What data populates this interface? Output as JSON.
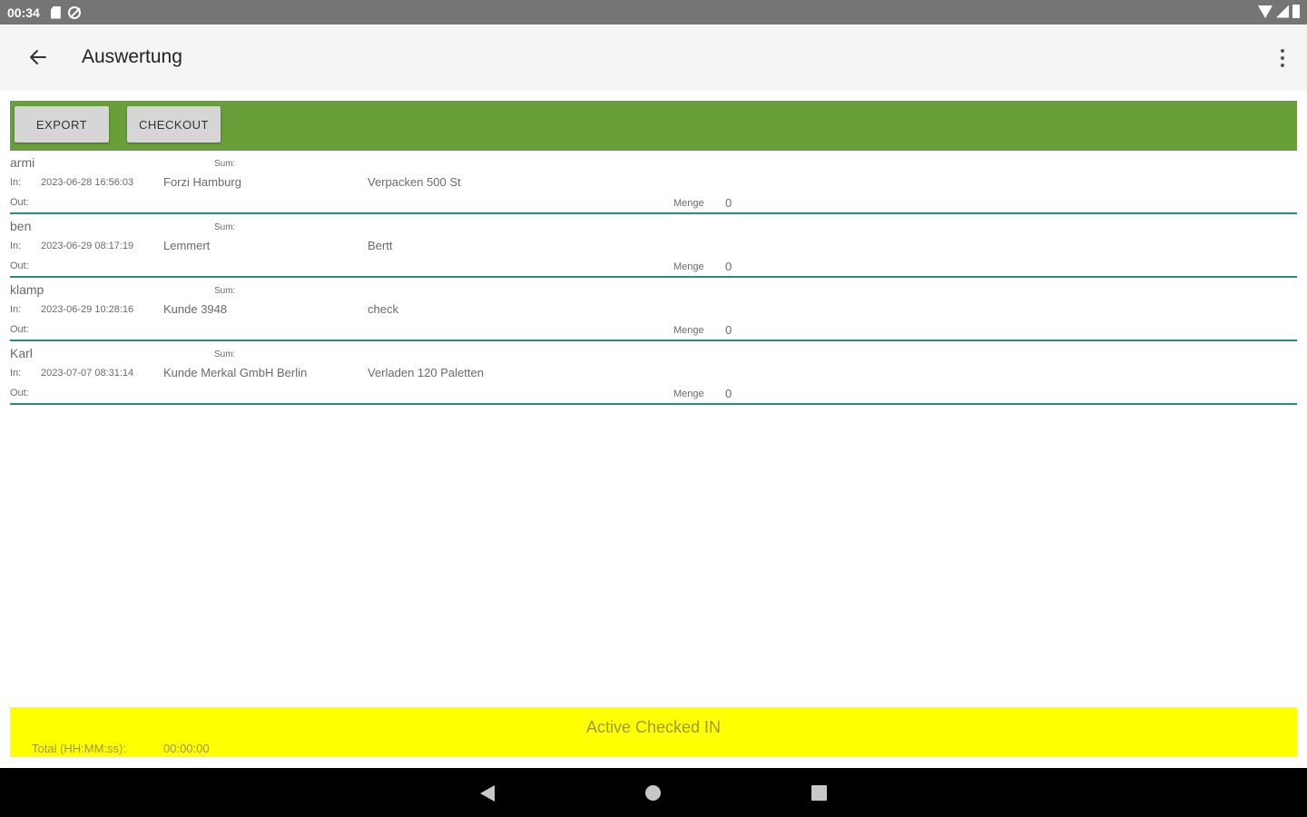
{
  "status_bar": {
    "time": "00:34"
  },
  "app_bar": {
    "title": "Auswertung"
  },
  "toolbar": {
    "export_label": "EXPORT",
    "checkout_label": "CHECKOUT"
  },
  "entries": [
    {
      "name": "armi",
      "sum_label": "Sum:",
      "in_label": "In:",
      "in_time": "2023-06-28 16:56:03",
      "customer": "Forzi Hamburg",
      "task": "Verpacken 500 St",
      "out_label": "Out:",
      "menge_label": "Menge",
      "menge_value": "0"
    },
    {
      "name": "ben",
      "sum_label": "Sum:",
      "in_label": "In:",
      "in_time": "2023-06-29 08:17:19",
      "customer": "Lemmert",
      "task": "Bertt",
      "out_label": "Out:",
      "menge_label": "Menge",
      "menge_value": "0"
    },
    {
      "name": "klamp",
      "sum_label": "Sum:",
      "in_label": "In:",
      "in_time": "2023-06-29 10:28:16",
      "customer": "Kunde 3948",
      "task": "check",
      "out_label": "Out:",
      "menge_label": "Menge",
      "menge_value": "0"
    },
    {
      "name": "Karl",
      "sum_label": "Sum:",
      "in_label": "In:",
      "in_time": "2023-07-07 08:31:14",
      "customer": "Kunde Merkal GmbH Berlin",
      "task": "Verladen 120 Paletten",
      "out_label": "Out:",
      "menge_label": "Menge",
      "menge_value": "0"
    }
  ],
  "active_panel": {
    "title": "Active Checked IN",
    "total_label": "Total (HH:MM:ss):",
    "total_value": "00:00:00"
  },
  "colors": {
    "status_bar": "#757575",
    "toolbar_green": "#689f38",
    "divider_teal": "#26917b",
    "panel_yellow": "#ffff00"
  },
  "icons": {
    "back": "arrow-left-icon",
    "overflow": "more-vert-icon"
  }
}
